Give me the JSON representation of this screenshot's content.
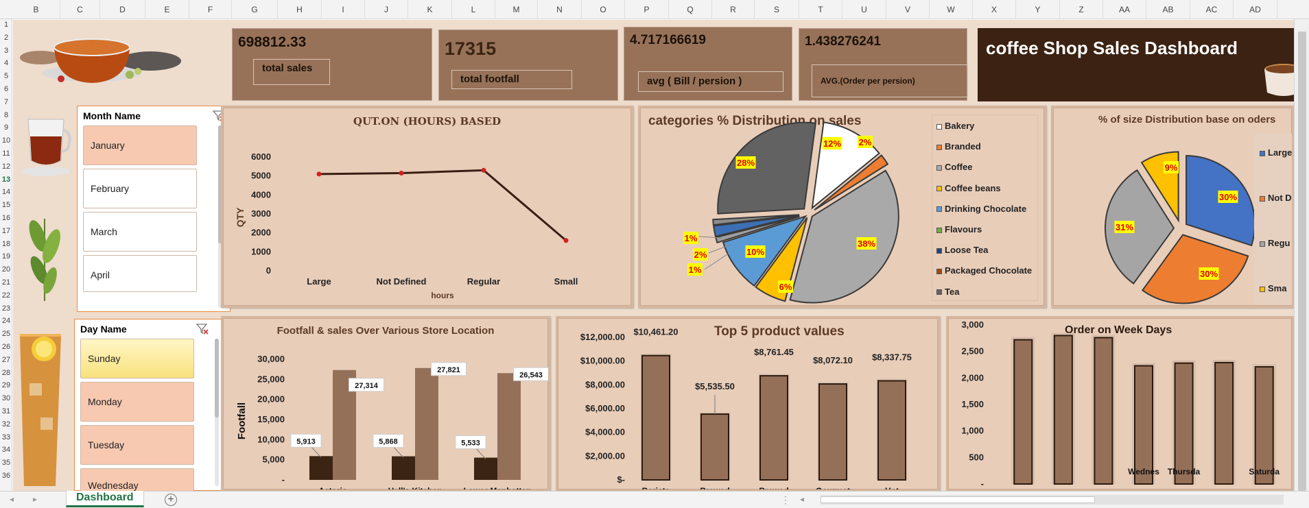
{
  "columns": [
    "B",
    "C",
    "D",
    "E",
    "F",
    "G",
    "H",
    "I",
    "J",
    "K",
    "L",
    "M",
    "N",
    "O",
    "P",
    "Q",
    "R",
    "S",
    "T",
    "U",
    "V",
    "W",
    "X",
    "Y",
    "Z",
    "AA",
    "AB",
    "AC",
    "AD"
  ],
  "rows": [
    "1",
    "2",
    "3",
    "4",
    "5",
    "6",
    "7",
    "8",
    "9",
    "10",
    "11",
    "12",
    "13",
    "14",
    "15",
    "16",
    "17",
    "18",
    "19",
    "20",
    "21",
    "22",
    "23",
    "24",
    "25",
    "26",
    "27",
    "28",
    "29",
    "30",
    "31",
    "32",
    "33",
    "34",
    "35",
    "36"
  ],
  "selected_row": "13",
  "kpis": {
    "total_sales": {
      "value": "698812.33",
      "label": "total sales"
    },
    "total_footfall": {
      "value": "17315",
      "label": "total footfall"
    },
    "avg_bill": {
      "value": "4.717166619",
      "label": "avg ( Bill / persion )"
    },
    "avg_order": {
      "value": "1.438276241",
      "label": "AVG.(Order per persion)"
    }
  },
  "dashboard_title": "coffee Shop Sales Dashboard",
  "month_slicer": {
    "header": "Month Name",
    "items": [
      {
        "label": "January",
        "selected": true
      },
      {
        "label": "February",
        "selected": false
      },
      {
        "label": "March",
        "selected": false
      },
      {
        "label": "April",
        "selected": false
      }
    ]
  },
  "day_slicer": {
    "header": "Day Name",
    "items": [
      {
        "label": "Sunday",
        "selected": true
      },
      {
        "label": "Monday",
        "selected": true
      },
      {
        "label": "Tuesday",
        "selected": true
      },
      {
        "label": "Wednesday",
        "selected": true
      }
    ]
  },
  "sheet_tab": "Dashboard",
  "colors": {
    "panel": "#e8cdb9",
    "kpi_card": "#977259",
    "title_bar": "#3b2212",
    "bar": "#957058",
    "dark_bar": "#3b2413",
    "excel_green": "#217346"
  },
  "chart_data": [
    {
      "type": "line",
      "title": "QUT.ON (HOURS) BASED",
      "xlabel": "hours",
      "ylabel": "QTY",
      "categories": [
        "Large",
        "Not Defined",
        "Regular",
        "Small"
      ],
      "values": [
        5100,
        5150,
        5300,
        1600
      ],
      "ylim": [
        0,
        6000
      ],
      "yticks": [
        "0",
        "1000",
        "2000",
        "3000",
        "4000",
        "5000",
        "6000"
      ]
    },
    {
      "type": "pie",
      "title": "categories % Distribution on sales",
      "slices": [
        {
          "label": "Coffee",
          "value": 38,
          "text": "38%",
          "color": "#a9a9a9"
        },
        {
          "label": "Coffee beans",
          "value": 6,
          "text": "6%",
          "color": "#ffc000"
        },
        {
          "label": "Drinking Chocolate",
          "value": 10,
          "text": "10%",
          "color": "#5b9bd5"
        },
        {
          "label": "Flavours",
          "value": 1,
          "text": "1%",
          "color": "#9e9e9e"
        },
        {
          "label": "Loose Tea",
          "value": 2,
          "text": "2%",
          "color": "#3d6fb5"
        },
        {
          "label": "Packaged Chocolate",
          "value": 1,
          "text": "1%",
          "color": "#8c8c8c"
        },
        {
          "label": "Tea",
          "value": 28,
          "text": "28%",
          "color": "#626262"
        },
        {
          "label": "Bakery",
          "value": 12,
          "text": "12%",
          "color": "#ffffff"
        },
        {
          "label": "Branded",
          "value": 2,
          "text": "2%",
          "color": "#ed7d31"
        }
      ],
      "legend": [
        "Bakery",
        "Branded",
        "Coffee",
        "Coffee beans",
        "Drinking Chocolate",
        "Flavours",
        "Loose Tea",
        "Packaged Chocolate",
        "Tea"
      ],
      "legend_colors": [
        "#ffffff",
        "#ed7d31",
        "#a9a9a9",
        "#ffc000",
        "#5b9bd5",
        "#70ad47",
        "#264478",
        "#9e480e",
        "#636363"
      ]
    },
    {
      "type": "pie",
      "title": "% of size Distribution base on oders",
      "slices": [
        {
          "label": "Large",
          "value": 30,
          "text": "30%",
          "color": "#4472c4"
        },
        {
          "label": "Not Defined",
          "value": 30,
          "text": "30%",
          "color": "#ed7d31"
        },
        {
          "label": "Regular",
          "value": 31,
          "text": "31%",
          "color": "#a5a5a5"
        },
        {
          "label": "Small",
          "value": 9,
          "text": "9%",
          "color": "#ffc000"
        }
      ],
      "legend": [
        "Large",
        "Not D",
        "Regu",
        "Sma"
      ]
    },
    {
      "type": "bar",
      "title": "Footfall & sales Over Various Store Location",
      "ylabel": "Footfall",
      "categories": [
        "Astoria",
        "Hell's Kitchen",
        "Lower Manhatten"
      ],
      "series": [
        {
          "values": [
            5913,
            5868,
            5533
          ],
          "labels": [
            "5,913",
            "5,868",
            "5,533"
          ]
        },
        {
          "values": [
            27314,
            27821,
            26543
          ],
          "labels": [
            "27,314",
            "27,821",
            "26,543"
          ]
        }
      ],
      "ylim": [
        0,
        30000
      ],
      "yticks": [
        "-",
        "5,000",
        "10,000",
        "15,000",
        "20,000",
        "25,000",
        "30,000"
      ]
    },
    {
      "type": "bar",
      "title": "Top 5 product values",
      "categories": [
        "Barista",
        "Brewed",
        "Brewed",
        "Gourmet",
        "Hot"
      ],
      "values": [
        10461.2,
        5535.5,
        8761.45,
        8072.1,
        8337.75
      ],
      "labels": [
        "$10,461.20",
        "$5,535.50",
        "$8,761.45",
        "$8,072.10",
        "$8,337.75"
      ],
      "ylim": [
        0,
        12000
      ],
      "yticks": [
        "$-",
        "$2,000.00",
        "$4,000.00",
        "$6,000.00",
        "$8,000.00",
        "$10,000.00",
        "$12,000.00"
      ]
    },
    {
      "type": "bar",
      "title": "Order on Week Days",
      "categories": [
        "",
        "",
        "",
        "Wednes",
        "Thursda",
        "",
        "Saturda"
      ],
      "values": [
        2720,
        2800,
        2760,
        2230,
        2280,
        2290,
        2210
      ],
      "ylim": [
        0,
        3000
      ],
      "yticks": [
        "-",
        "500",
        "1,000",
        "1,500",
        "2,000",
        "2,500",
        "3,000"
      ]
    }
  ]
}
